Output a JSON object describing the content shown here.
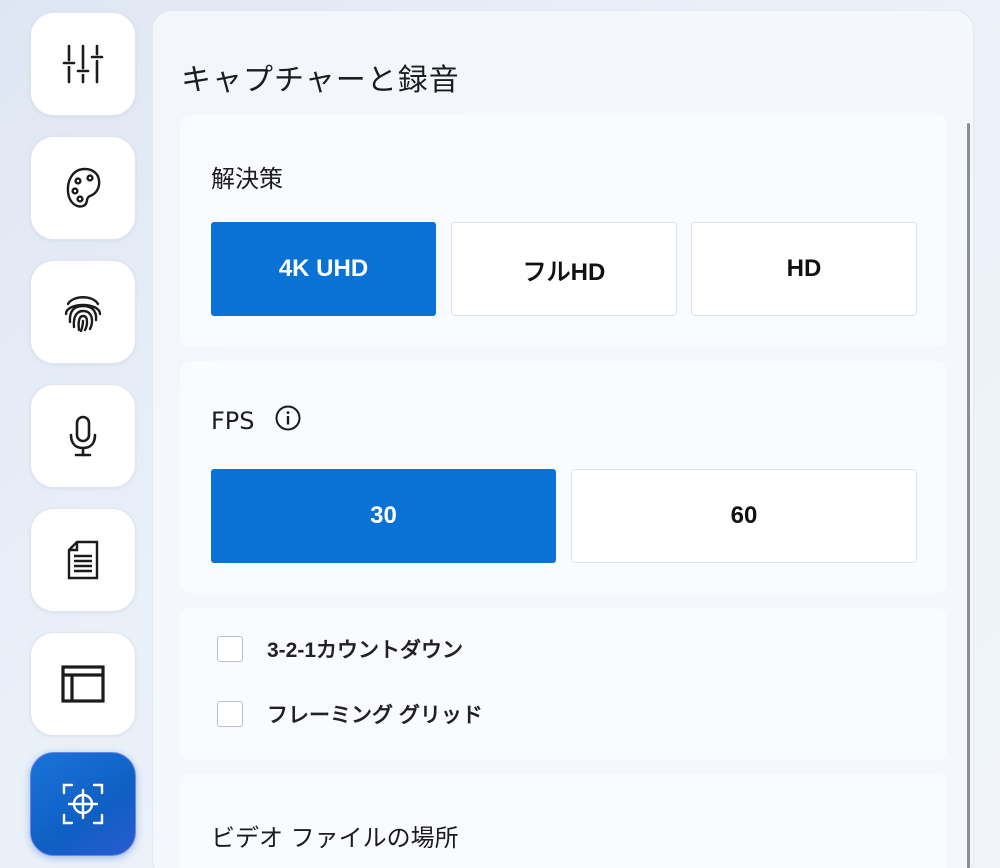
{
  "sidebar": {
    "items": [
      {
        "icon": "sliders-icon",
        "active": false
      },
      {
        "icon": "palette-icon",
        "active": false
      },
      {
        "icon": "fingerprint-icon",
        "active": false
      },
      {
        "icon": "microphone-icon",
        "active": false
      },
      {
        "icon": "document-icon",
        "active": false
      },
      {
        "icon": "layout-icon",
        "active": false
      },
      {
        "icon": "capture-target-icon",
        "active": true
      }
    ]
  },
  "main": {
    "title": "キャプチャーと録音",
    "resolution": {
      "label": "解決策",
      "options": [
        "4K UHD",
        "フルHD",
        "HD"
      ],
      "selected": "4K UHD"
    },
    "fps": {
      "label": "FPS",
      "info_icon": "info-icon",
      "options": [
        "30",
        "60"
      ],
      "selected": "30"
    },
    "toggles": [
      {
        "label": "3-2-1カウントダウン",
        "checked": false
      },
      {
        "label": "フレーミング グリッド",
        "checked": false
      }
    ],
    "video_location": {
      "label": "ビデオ ファイルの場所"
    }
  },
  "colors": {
    "accent": "#0a72d4",
    "card_bg": "#f9fbfe",
    "active_nav": "#1a73d9"
  }
}
